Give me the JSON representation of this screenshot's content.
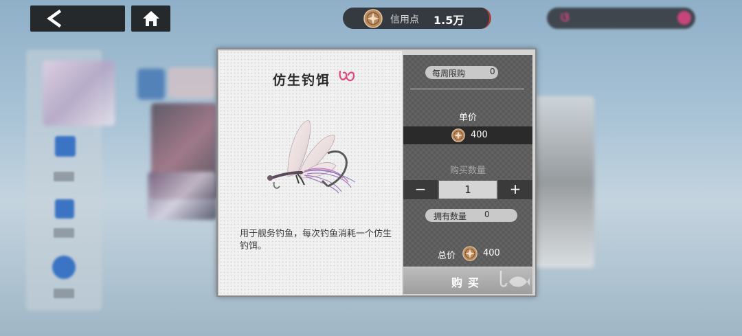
{
  "topbar": {
    "back_icon": "back-arrow-icon",
    "home_icon": "home-icon",
    "credit_label": "信用点",
    "credit_value": "1.5万",
    "accent": "#a8403a"
  },
  "item": {
    "name": "仿生钓饵",
    "brand_icon": "brand-logo-icon",
    "brand_color": "#e0457f",
    "description": "用于舰务钓鱼，每次钓鱼消耗一个仿生钓饵。"
  },
  "purchase": {
    "weekly_limit_label": "每周限购",
    "weekly_limit_value": "0",
    "unit_price_label": "单价",
    "unit_price": "400",
    "quantity_label": "购买数量",
    "quantity": "1",
    "minus_label": "−",
    "plus_label": "+",
    "owned_label": "拥有数量",
    "owned_value": "0",
    "total_label": "总价",
    "total_price": "400",
    "buy_label": "购买"
  }
}
